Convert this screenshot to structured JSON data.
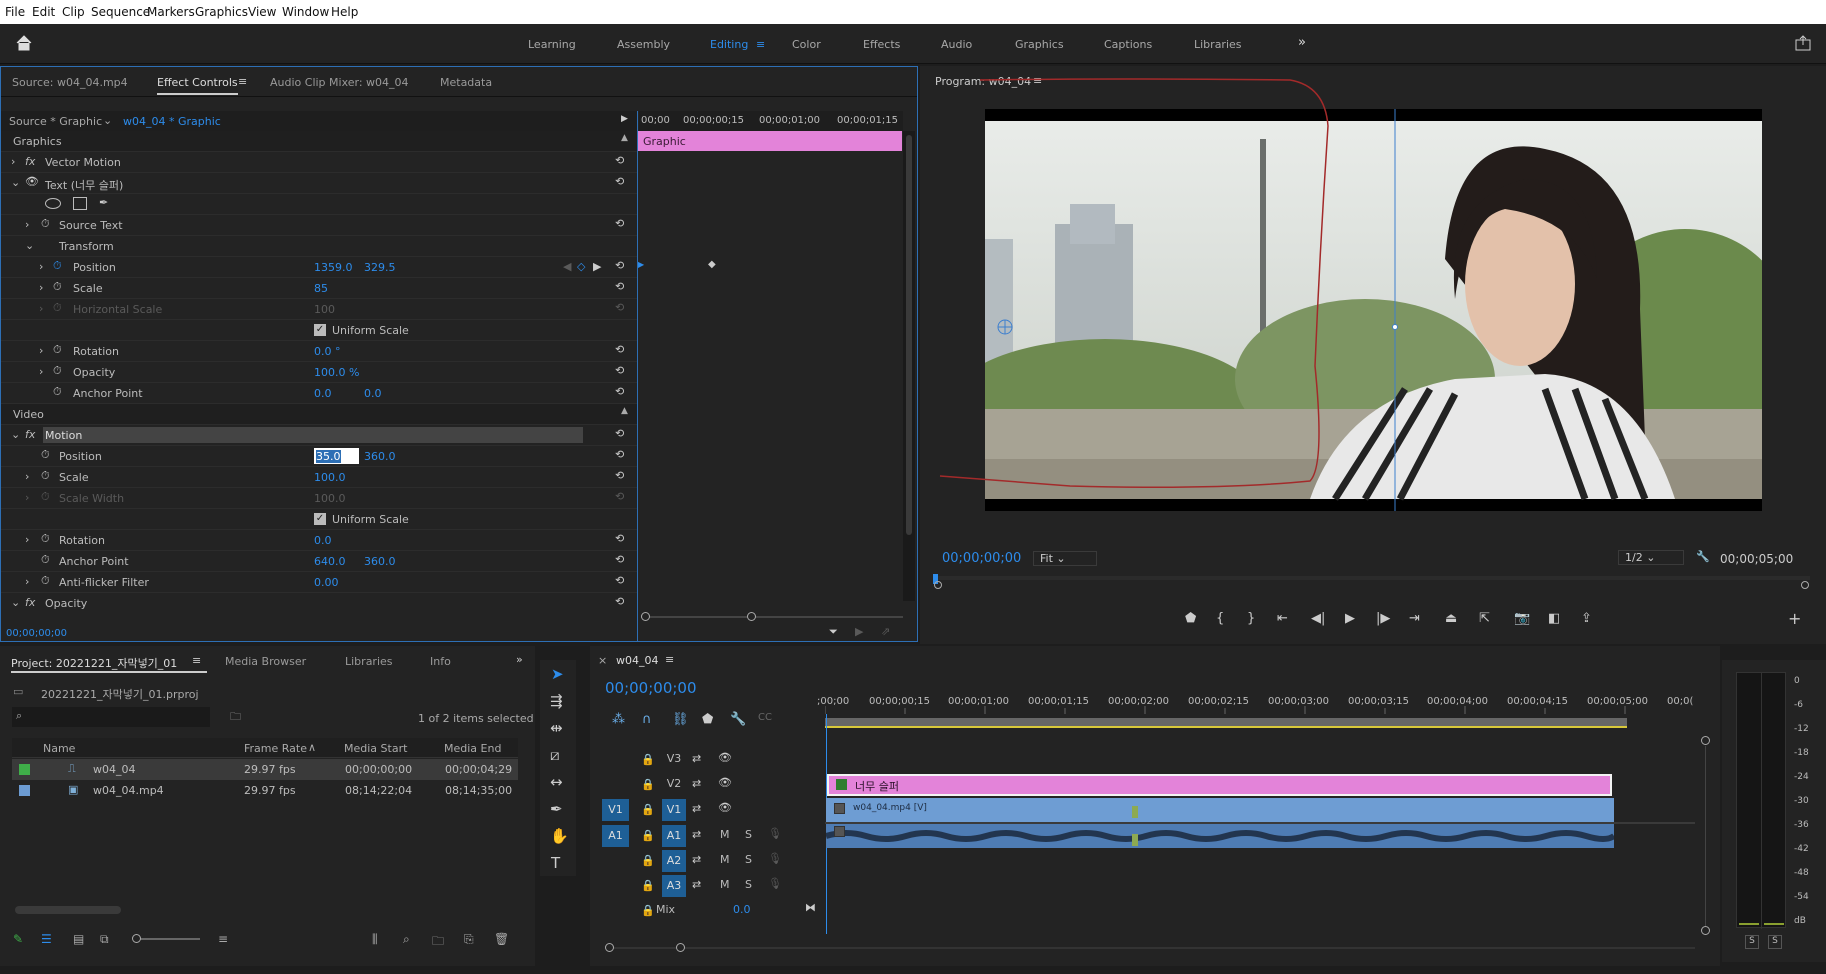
{
  "menu": [
    "File",
    "Edit",
    "Clip",
    "Sequence",
    "Markers",
    "Graphics",
    "View",
    "Window",
    "Help"
  ],
  "workspaces": [
    "Learning",
    "Assembly",
    "Editing",
    "Color",
    "Effects",
    "Audio",
    "Graphics",
    "Captions",
    "Libraries"
  ],
  "ec": {
    "tabs": [
      "Source: w04_04.mp4",
      "Effect Controls",
      "Audio Clip Mixer: w04_04",
      "Metadata"
    ],
    "source_label": "Source * Graphic",
    "seq_label": "w04_04 * Graphic",
    "ruler": [
      "00;00",
      "00;00;00;15",
      "00;00;01;00",
      "00;00;01;15"
    ],
    "graphic_clip": "Graphic",
    "section_graphics": "Graphics",
    "section_video": "Video",
    "vector_motion": "Vector Motion",
    "text_layer": "Text (너무 슬퍼)",
    "source_text": "Source Text",
    "transform": "Transform",
    "g_position": "Position",
    "g_position_x": "1359.0",
    "g_position_y": "329.5",
    "g_scale": "Scale",
    "g_scale_val": "85",
    "g_hscale": "Horizontal Scale",
    "g_hscale_val": "100",
    "uniform": "Uniform Scale",
    "g_rotation": "Rotation",
    "g_rotation_val": "0.0 °",
    "g_opacity": "Opacity",
    "g_opacity_val": "100.0 %",
    "g_anchor": "Anchor Point",
    "g_anchor_x": "0.0",
    "g_anchor_y": "0.0",
    "motion": "Motion",
    "v_position": "Position",
    "v_position_x": "35.0",
    "v_position_y": "360.0",
    "v_scale": "Scale",
    "v_scale_val": "100.0",
    "v_scalew": "Scale Width",
    "v_scalew_val": "100.0",
    "v_rotation": "Rotation",
    "v_rotation_val": "0.0",
    "v_anchor": "Anchor Point",
    "v_anchor_x": "640.0",
    "v_anchor_y": "360.0",
    "v_flicker": "Anti-flicker Filter",
    "v_flicker_val": "0.00",
    "v_opacity": "Opacity",
    "timecode": "00;00;00;00"
  },
  "program": {
    "title": "Program: w04_04",
    "timecode": "00;00;00;00",
    "fit": "Fit",
    "resolution": "1/2",
    "duration": "00;00;05;00"
  },
  "project": {
    "tabs": [
      "Project: 20221221_자막넣기_01",
      "Media Browser",
      "Libraries",
      "Info"
    ],
    "file": "20221221_자막넣기_01.prproj",
    "selected": "1 of 2 items selected",
    "columns": [
      "Name",
      "Frame Rate",
      "Media Start",
      "Media End"
    ],
    "rows": [
      {
        "name": "w04_04",
        "fps": "29.97 fps",
        "start": "00;00;00;00",
        "end": "00;00;04;29",
        "color": "#3fae49"
      },
      {
        "name": "w04_04.mp4",
        "fps": "29.97 fps",
        "start": "08;14;22;04",
        "end": "08;14;35;00",
        "color": "#6c9bd2"
      }
    ]
  },
  "timeline": {
    "title": "w04_04",
    "timecode": "00;00;00;00",
    "ruler": [
      ";00;00",
      "00;00;00;15",
      "00;00;01;00",
      "00;00;01;15",
      "00;00;02;00",
      "00;00;02;15",
      "00;00;03;00",
      "00;00;03;15",
      "00;00;04;00",
      "00;00;04;15",
      "00;00;05;00",
      "00;0("
    ],
    "tracks": [
      "V3",
      "V2",
      "V1",
      "A1",
      "A2",
      "A3"
    ],
    "src_v1": "V1",
    "src_a1": "A1",
    "text_clip": "너무 슬퍼",
    "video_clip": "w04_04.mp4 [V]",
    "mix": "Mix",
    "mix_val": "0.0",
    "m": "M",
    "s": "S"
  },
  "meter": {
    "ticks": [
      "0",
      "-6",
      "-12",
      "-18",
      "-24",
      "-30",
      "-36",
      "-42",
      "-48",
      "-54",
      "dB"
    ],
    "s": "S"
  }
}
